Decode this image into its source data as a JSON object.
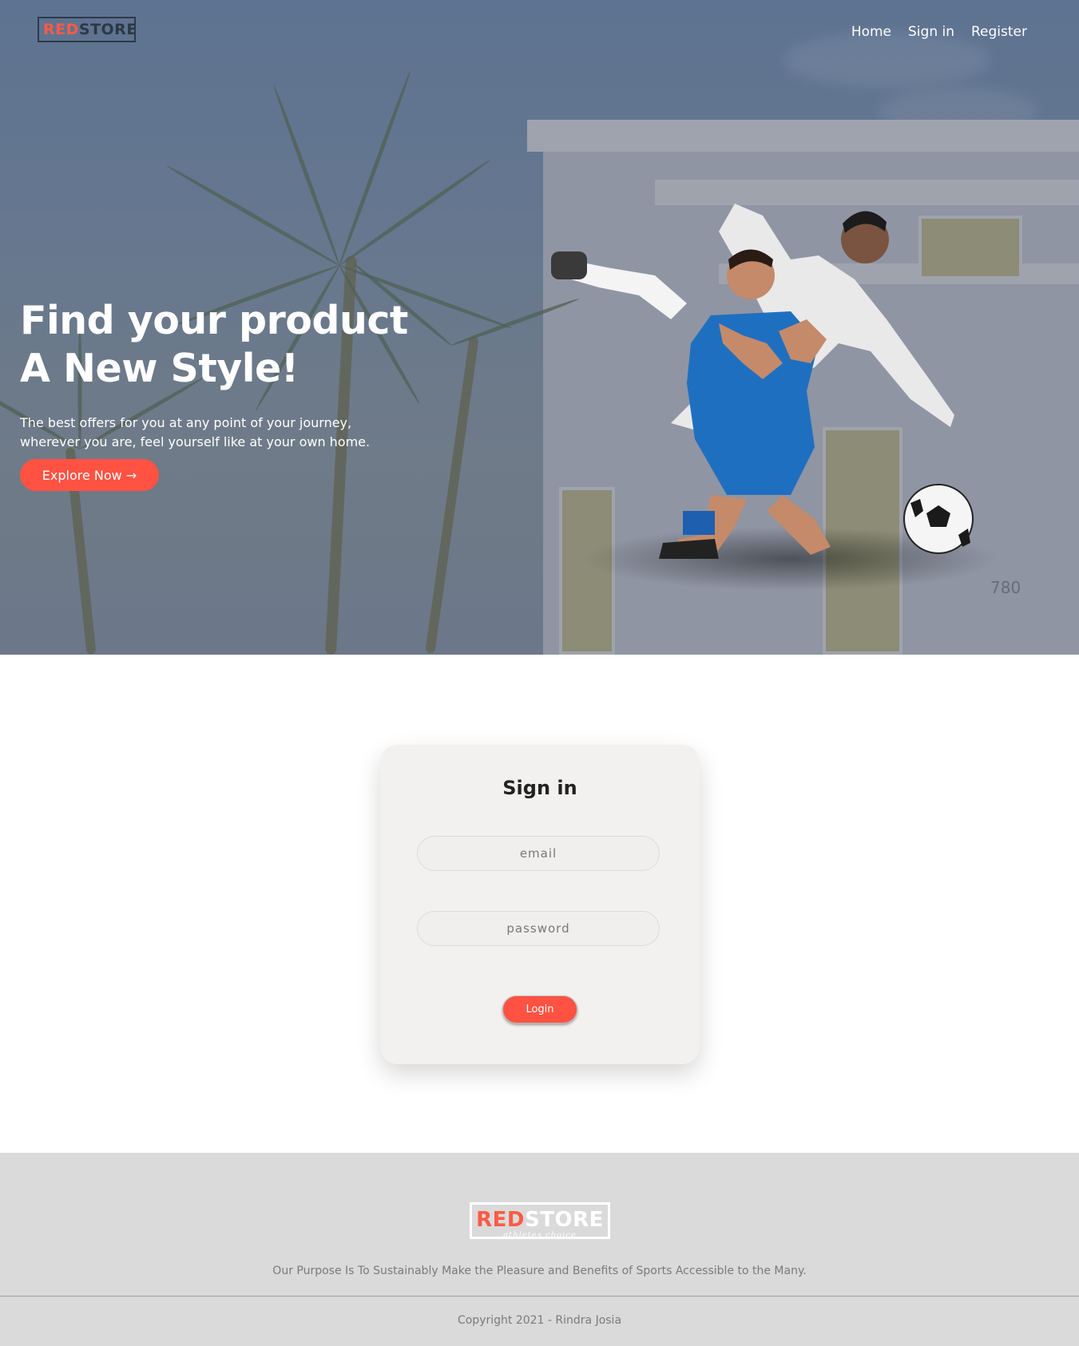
{
  "header": {
    "logo": {
      "red": "RED",
      "dark": "STORE"
    },
    "nav": [
      {
        "label": "Home"
      },
      {
        "label": "Sign in"
      },
      {
        "label": "Register"
      }
    ]
  },
  "hero": {
    "title_line1": "Find your product",
    "title_line2": "A New Style!",
    "text_line1": "The best offers for you at any point of your journey,",
    "text_line2": "wherever you are, feel yourself like at your own home.",
    "cta_label": "Explore Now →",
    "watermark": "780"
  },
  "signin": {
    "title": "Sign in",
    "email_placeholder": "email",
    "password_placeholder": "password",
    "login_label": "Login"
  },
  "footer": {
    "logo": {
      "red": "RED",
      "white": "STORE",
      "tagline": "athletes choice"
    },
    "purpose": "Our Purpose Is To Sustainably Make the Pleasure and Benefits of Sports Accessible to the Many.",
    "copyright": "Copyright 2021 - Rindra Josia"
  },
  "colors": {
    "accent": "#ff5242",
    "hero_overlay": "#5d7391",
    "footer_bg": "#dadada"
  }
}
